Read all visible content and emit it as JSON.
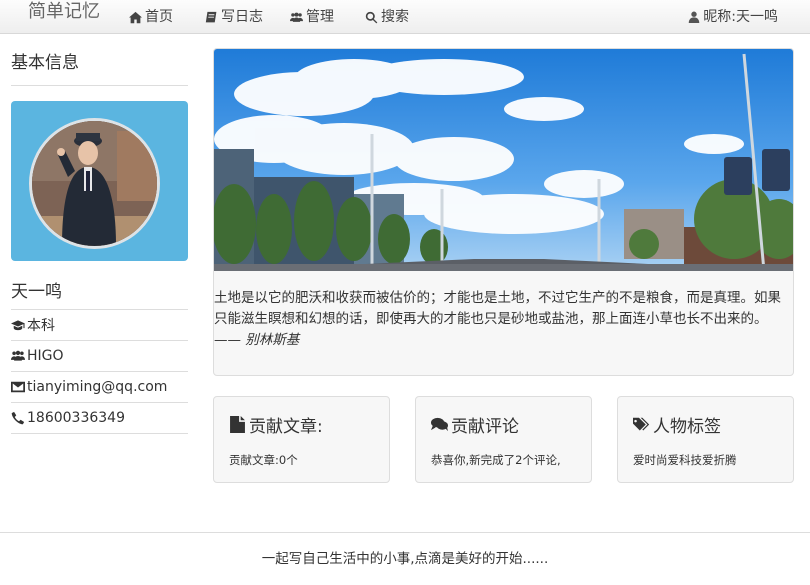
{
  "nav": {
    "brand": "简单记忆",
    "items": [
      {
        "label": "首页",
        "icon": "home-icon"
      },
      {
        "label": "写日志",
        "icon": "book-icon"
      },
      {
        "label": "管理",
        "icon": "users-icon"
      },
      {
        "label": "搜索",
        "icon": "search-icon"
      }
    ],
    "user": "昵称:天一鸣"
  },
  "sidebar": {
    "title": "基本信息",
    "name": "天一鸣",
    "education": "本科",
    "company": "HIGO",
    "email": "tianyiming@qq.com",
    "phone": "18600336349"
  },
  "main": {
    "quote": "土地是以它的肥沃和收获而被估价的；才能也是土地，不过它生产的不是粮食，而是真理。如果只能滋生瞑想和幻想的话，即使再大的才能也只是砂地或盐池，那上面连小草也长不出来的。 —— ",
    "quote_author": "别林斯基",
    "cards": [
      {
        "title": "贡献文章:",
        "text": "贡献文章:0个",
        "icon": "file-icon"
      },
      {
        "title": "贡献评论",
        "text": "恭喜你,新完成了2个评论,",
        "icon": "comments-icon"
      },
      {
        "title": "人物标签",
        "text": "爱时尚爱科技爱折腾",
        "icon": "tags-icon"
      }
    ]
  },
  "footer": {
    "text": "一起写自己生活中的小事,点滴是美好的开始......"
  }
}
